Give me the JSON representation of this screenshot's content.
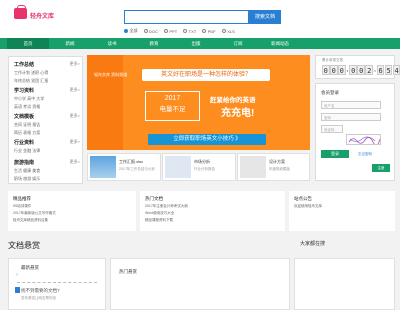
{
  "logo": {
    "text": "轻舟文库",
    "color": "#e8336d"
  },
  "search": {
    "placeholder": "",
    "button_label": "搜索文档",
    "formats": [
      "全部",
      "DOC",
      "PPT",
      "TXT",
      "PDF",
      "XLS"
    ],
    "selected_format": "全部"
  },
  "nav": {
    "items": [
      "首页",
      "新闻",
      "读书",
      "教育",
      "出版",
      "订阅",
      "新闻动态"
    ],
    "active_index": 0
  },
  "categories": [
    {
      "title": "工作总结",
      "more": "更多>",
      "lines": [
        "工作计划 述职 心得",
        "年终总结 党团 汇报"
      ]
    },
    {
      "title": "学习资料",
      "more": "更多>",
      "lines": [
        "中小学 高中 大学",
        "英语 考试 资格"
      ]
    },
    {
      "title": "文档模板",
      "more": "更多>",
      "lines": [
        "合同 证明 报告",
        "简历 表格 方案"
      ]
    },
    {
      "title": "行业资料",
      "more": "更多>",
      "lines": [
        "行业 金融 法律"
      ]
    },
    {
      "title": "旅游指南",
      "more": "更多>",
      "lines": [
        "生活 健康 美食",
        "职场 旅游 娱乐"
      ]
    }
  ],
  "banner": {
    "mini_logo": "轻舟文库 资料频道",
    "speech": "英文好在职场是一种怎样的体验？",
    "year": "2017",
    "calendar_text": "电量不足",
    "slogan1": "赶紧给你的英语",
    "slogan2": "充充电!",
    "cta": "立即获取职场英文小技巧 》",
    "bg_color": "#fd8d1f",
    "cta_color": "#1794d6"
  },
  "thumbs": [
    {
      "title": "工作汇报.xlsx",
      "sub": "2017年工作总结与计划"
    },
    {
      "title": "市场分析",
      "sub": "行业分析报告"
    },
    {
      "title": "设计方案",
      "sub": "年度规划模板"
    }
  ],
  "counter": {
    "label": "累计收录文档",
    "digits": [
      "0",
      "0",
      "0",
      "0",
      "0",
      "2",
      "6",
      "5",
      "4"
    ]
  },
  "login": {
    "title": "会员登录",
    "user_placeholder": "用户名",
    "pass_placeholder": "密码",
    "code_placeholder": "验证码",
    "login_button": "登录",
    "forgot_link": "忘记密码",
    "register_button": "注册"
  },
  "info_boxes": [
    {
      "title": "精品推荐",
      "lines": [
        "5S培训课件",
        "2017年最新版公文写作格式",
        "轻舟文库精品资料合集"
      ]
    },
    {
      "title": "热门文档",
      "lines": [
        "2017年注册会计师考试大纲",
        "Word使用技巧大全",
        "精品课程资料下载"
      ]
    },
    {
      "title": "站点公告",
      "lines": [
        "欢迎使用轻舟文库"
      ]
    }
  ],
  "section": {
    "title": "文档悬赏",
    "right_title": "大家都在搜"
  },
  "cards": [
    {
      "head": "最新悬赏",
      "text": "找不到需要的文档?",
      "sub": "发布悬赏让网友帮你找"
    },
    {
      "head": "热门悬赏"
    }
  ]
}
